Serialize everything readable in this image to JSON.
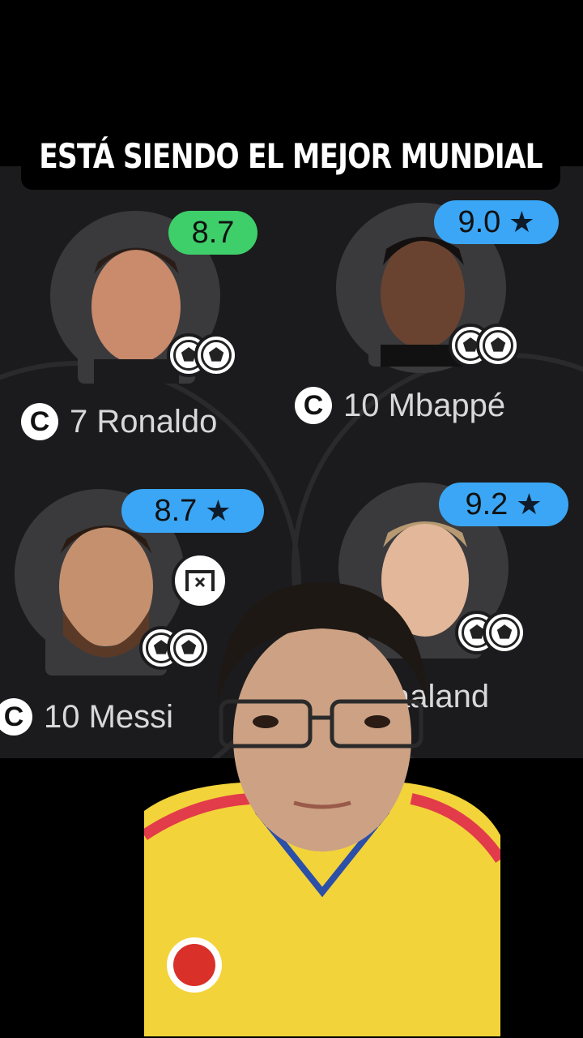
{
  "title": "ESTÁ SIENDO EL MEJOR MUNDIAL",
  "players": [
    {
      "number_name": "7 Ronaldo",
      "rating": "8.7",
      "star": false,
      "rating_color": "#3ecf6a",
      "captain_mark": "C",
      "goals": 2
    },
    {
      "number_name": "10 Mbappé",
      "rating": "9.0",
      "star": true,
      "rating_color": "#3aa6f5",
      "captain_mark": "C",
      "goals": 2
    },
    {
      "number_name": "10 Messi",
      "rating": "8.7",
      "star": true,
      "rating_color": "#3aa6f5",
      "captain_mark": "C",
      "goals": 2
    },
    {
      "number_name": "aaland",
      "rating": "9.2",
      "star": true,
      "rating_color": "#3aa6f5",
      "captain_mark": "",
      "goals": 2
    }
  ],
  "star_glyph": "★",
  "icons": {
    "goal": "soccer-ball-icon",
    "missed_penalty": "missed-goal-icon"
  }
}
